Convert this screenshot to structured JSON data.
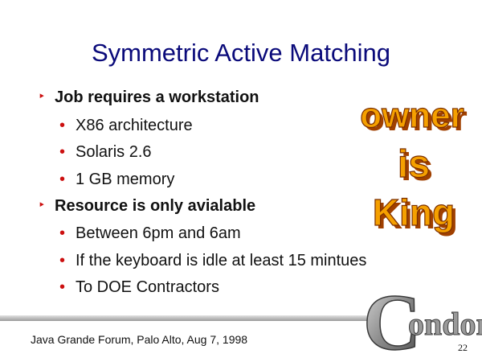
{
  "slide": {
    "title": "Symmetric Active Matching",
    "bullets": [
      {
        "text": "Job requires a workstation",
        "subitems": [
          "X86 architecture",
          "Solaris 2.6",
          "1 GB memory"
        ]
      },
      {
        "text": "Resource is only avialable",
        "subitems": [
          "Between 6pm and 6am",
          "If the keyboard is idle at least 15 mintues",
          "To DOE Contractors"
        ]
      }
    ],
    "slogan": [
      "owner",
      "is",
      "King"
    ],
    "logo_text": "ondor",
    "logo_initial": "C",
    "footer": "Java Grande Forum, Palo Alto, Aug 7, 1998",
    "page_number": "22",
    "bullet_marker_l1": "‣",
    "bullet_marker_l2": "•"
  },
  "colors": {
    "title": "#0a0a7a",
    "bullet_marker": "#cc1010",
    "slogan_fill": "#f5a000",
    "slogan_outline": "#a04000",
    "logo_gray": "#8a8a8a"
  }
}
